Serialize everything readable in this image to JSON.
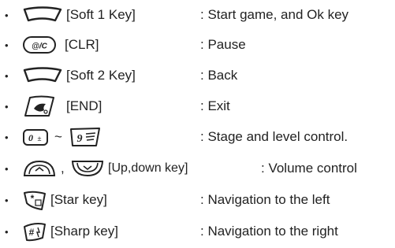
{
  "items": [
    {
      "icon": "soft-1-key-icon",
      "key": "[Soft 1 Key]",
      "desc": ": Start game, and Ok key"
    },
    {
      "icon": "clr-key-icon",
      "key": "[CLR]",
      "desc": ": Pause"
    },
    {
      "icon": "soft-2-key-icon",
      "key": "[Soft 2 Key]",
      "desc": ": Back"
    },
    {
      "icon": "end-key-icon",
      "key": "[END]",
      "desc": ": Exit"
    },
    {
      "icon": "number-keys-icon",
      "icon2": "nine-key-icon",
      "separator": "~",
      "key": "",
      "desc": ": Stage and level control."
    },
    {
      "icon": "up-key-icon",
      "icon2": "down-key-icon",
      "separator": ",",
      "key": "[Up,down key]",
      "desc": ": Volume control"
    },
    {
      "icon": "star-key-icon",
      "key": "[Star key]",
      "desc": ": Navigation to the left"
    },
    {
      "icon": "sharp-key-icon",
      "key": "[Sharp key]",
      "desc": ": Navigation to the right"
    }
  ],
  "bullet": "•"
}
